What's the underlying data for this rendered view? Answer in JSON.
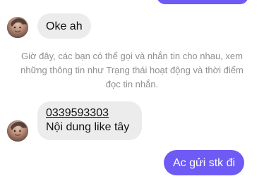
{
  "messages": [
    {
      "side": "outgoing",
      "text": "",
      "clipped": true
    },
    {
      "side": "incoming",
      "text": "Oke ah"
    },
    {
      "side": "system",
      "text": "Giờ đây, các bạn có thể gọi và nhắn tin cho nhau, xem những thông tin như Trạng thái hoạt động và thời điểm đọc tin nhắn."
    },
    {
      "side": "incoming",
      "phone": "0339593303",
      "text": "Nội dung like tây"
    },
    {
      "side": "outgoing",
      "text": "Ac gửi stk đi"
    }
  ],
  "colors": {
    "incoming_bubble": "#ececec",
    "outgoing_bubble": "#6e5bf5",
    "system_text": "#8f8f93",
    "text_dark": "#111111",
    "text_light": "#ffffff"
  },
  "icons": {
    "avatar": "user-avatar-photo"
  }
}
